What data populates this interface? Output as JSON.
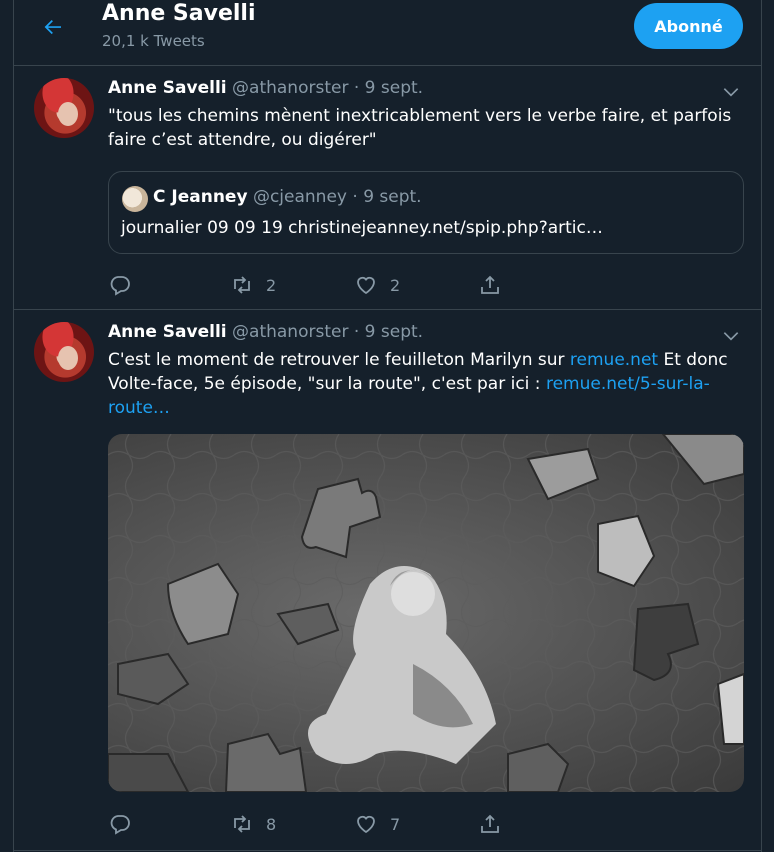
{
  "header": {
    "title": "Anne Savelli",
    "subtitle": "20,1 k Tweets",
    "follow_label": "Abonné"
  },
  "tweets": [
    {
      "name": "Anne Savelli",
      "handle": "@athanorster",
      "dot": "·",
      "date": "9 sept.",
      "text": "\"tous les chemins mènent inextricablement vers le verbe faire, et parfois faire c’est attendre, ou digérer\"",
      "quote": {
        "name": "C Jeanney",
        "handle": "@cjeanney",
        "dot": "·",
        "date": "9 sept.",
        "text": "journalier 09 09 19  christinejeanney.net/spip.php?artic…"
      },
      "reply_count": "",
      "retweet_count": "2",
      "like_count": "2"
    },
    {
      "name": "Anne Savelli",
      "handle": "@athanorster",
      "dot": "·",
      "date": "9 sept.",
      "text_part1": "C'est le moment de retrouver le feuilleton Marilyn sur ",
      "link1": "remue.net",
      "text_part2": " Et donc Volte-face, 5e épisode, \"sur la route\", c'est par ici : ",
      "link2": "remue.net/5-sur-la-route…",
      "reply_count": "",
      "retweet_count": "8",
      "like_count": "7"
    }
  ],
  "icons": {
    "back": "arrow-left-icon",
    "chevron": "chevron-down-icon",
    "reply": "reply-icon",
    "retweet": "retweet-icon",
    "like": "heart-icon",
    "share": "share-icon"
  },
  "colors": {
    "background": "#15202b",
    "accent": "#1da1f2",
    "muted": "#8899a6",
    "border": "#38444d"
  }
}
